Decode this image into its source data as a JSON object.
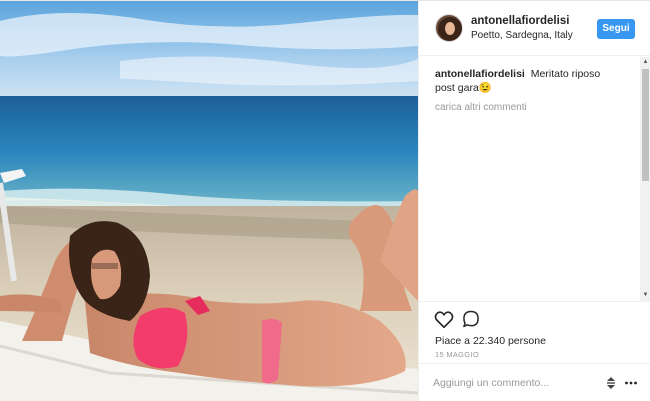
{
  "header": {
    "username": "antonellafiordelisi",
    "location": "Poetto, Sardegna, Italy",
    "follow_label": "Segui"
  },
  "caption": {
    "username": "antonellafiordelisi",
    "text": "Meritato riposo post gara😉"
  },
  "comments": {
    "load_more_label": "carica altri commenti"
  },
  "actions": {
    "like_icon": "heart-outline-icon",
    "comment_icon": "speech-bubble-icon"
  },
  "likes_text": "Piace a 22.340 persone",
  "date_text": "15 MAGGIO",
  "comment_box": {
    "placeholder": "Aggiungi un commento...",
    "sort_icon": "up-down-arrows-icon",
    "more_icon": "ellipsis-icon"
  },
  "colors": {
    "follow_button": "#3897f0",
    "secondary_text": "#999999",
    "border": "#efefef"
  }
}
